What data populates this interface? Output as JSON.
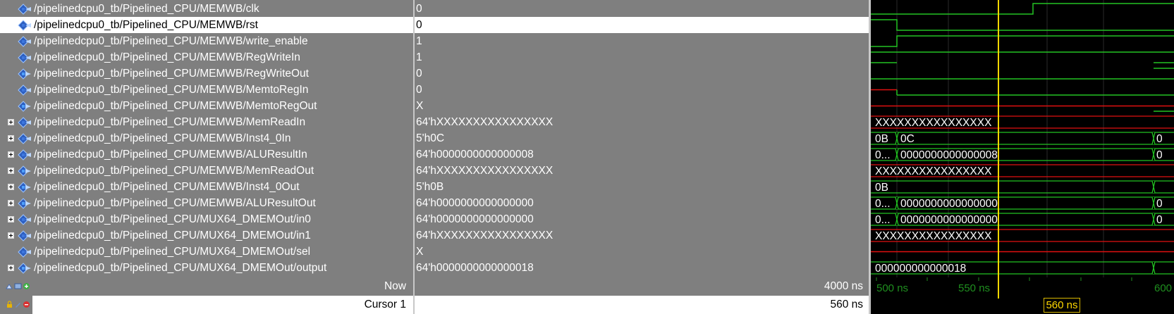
{
  "signals": [
    {
      "name": "/pipelinedcpu0_tb/Pipelined_CPU/MEMWB/clk",
      "value": "0",
      "expandable": false,
      "kind": "in"
    },
    {
      "name": "/pipelinedcpu0_tb/Pipelined_CPU/MEMWB/rst",
      "value": "0",
      "expandable": false,
      "kind": "in",
      "selected": true
    },
    {
      "name": "/pipelinedcpu0_tb/Pipelined_CPU/MEMWB/write_enable",
      "value": "1",
      "expandable": false,
      "kind": "in"
    },
    {
      "name": "/pipelinedcpu0_tb/Pipelined_CPU/MEMWB/RegWriteIn",
      "value": "1",
      "expandable": false,
      "kind": "in"
    },
    {
      "name": "/pipelinedcpu0_tb/Pipelined_CPU/MEMWB/RegWriteOut",
      "value": "0",
      "expandable": false,
      "kind": "out"
    },
    {
      "name": "/pipelinedcpu0_tb/Pipelined_CPU/MEMWB/MemtoRegIn",
      "value": "0",
      "expandable": false,
      "kind": "in"
    },
    {
      "name": "/pipelinedcpu0_tb/Pipelined_CPU/MEMWB/MemtoRegOut",
      "value": "X",
      "expandable": false,
      "kind": "out"
    },
    {
      "name": "/pipelinedcpu0_tb/Pipelined_CPU/MEMWB/MemReadIn",
      "value": "64'hXXXXXXXXXXXXXXXX",
      "expandable": true,
      "kind": "in"
    },
    {
      "name": "/pipelinedcpu0_tb/Pipelined_CPU/MEMWB/Inst4_0In",
      "value": "5'h0C",
      "expandable": true,
      "kind": "in"
    },
    {
      "name": "/pipelinedcpu0_tb/Pipelined_CPU/MEMWB/ALUResultIn",
      "value": "64'h0000000000000008",
      "expandable": true,
      "kind": "in"
    },
    {
      "name": "/pipelinedcpu0_tb/Pipelined_CPU/MEMWB/MemReadOut",
      "value": "64'hXXXXXXXXXXXXXXXX",
      "expandable": true,
      "kind": "out"
    },
    {
      "name": "/pipelinedcpu0_tb/Pipelined_CPU/MEMWB/Inst4_0Out",
      "value": "5'h0B",
      "expandable": true,
      "kind": "out"
    },
    {
      "name": "/pipelinedcpu0_tb/Pipelined_CPU/MEMWB/ALUResultOut",
      "value": "64'h0000000000000000",
      "expandable": true,
      "kind": "out"
    },
    {
      "name": "/pipelinedcpu0_tb/Pipelined_CPU/MUX64_DMEMOut/in0",
      "value": "64'h0000000000000000",
      "expandable": true,
      "kind": "in"
    },
    {
      "name": "/pipelinedcpu0_tb/Pipelined_CPU/MUX64_DMEMOut/in1",
      "value": "64'hXXXXXXXXXXXXXXXX",
      "expandable": true,
      "kind": "in"
    },
    {
      "name": "/pipelinedcpu0_tb/Pipelined_CPU/MUX64_DMEMOut/sel",
      "value": "X",
      "expandable": false,
      "kind": "in"
    },
    {
      "name": "/pipelinedcpu0_tb/Pipelined_CPU/MUX64_DMEMOut/output",
      "value": "64'h0000000000000018",
      "expandable": true,
      "kind": "out"
    }
  ],
  "wave_labels": [
    {
      "row": 7,
      "segments": [
        "XXXXXXXXXXXXXXXX"
      ]
    },
    {
      "row": 8,
      "segments": [
        "0B",
        "0C",
        "0"
      ]
    },
    {
      "row": 9,
      "segments": [
        "0...",
        "0000000000000008",
        "0"
      ]
    },
    {
      "row": 10,
      "segments": [
        "XXXXXXXXXXXXXXXX"
      ]
    },
    {
      "row": 11,
      "segments": [
        "0B"
      ]
    },
    {
      "row": 12,
      "segments": [
        "0...",
        "0000000000000000",
        "0"
      ]
    },
    {
      "row": 13,
      "segments": [
        "0...",
        "0000000000000000",
        "0"
      ]
    },
    {
      "row": 14,
      "segments": [
        "XXXXXXXXXXXXXXXX"
      ]
    },
    {
      "row": 16,
      "segments": [
        "000000000000018"
      ]
    }
  ],
  "footer": {
    "now_label": "Now",
    "now_value": "4000 ns",
    "cursor_label": "Cursor 1",
    "cursor_value": "560 ns"
  },
  "time_axis": {
    "ticks": [
      "500 ns",
      "550 ns",
      "600"
    ],
    "cursor_time": "560 ns"
  },
  "colors": {
    "pane_bg": "#7f7f7f",
    "wave_bg": "#000000",
    "wave_green": "#22c322",
    "wave_red": "#e01010",
    "cursor_yellow": "#ffd800",
    "axis_green": "#1f8f1f"
  }
}
